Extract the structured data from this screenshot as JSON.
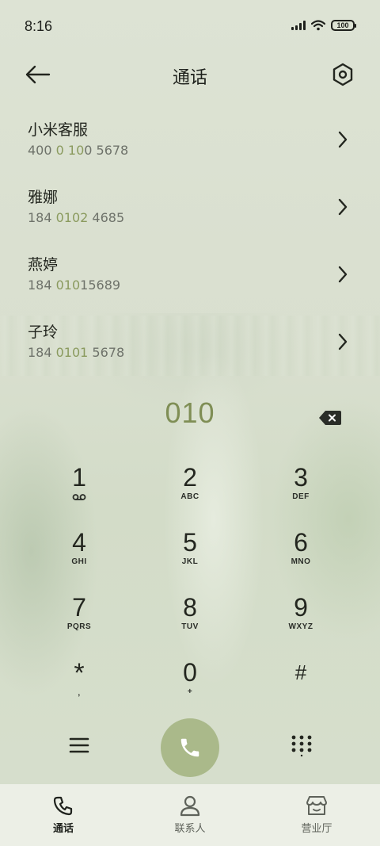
{
  "status_bar": {
    "time": "8:16",
    "battery": "100"
  },
  "header": {
    "title": "通话"
  },
  "contacts": [
    {
      "name": "小米客服",
      "number_pre": "400 ",
      "number_match": "0 10",
      "number_post": "0 5678"
    },
    {
      "name": "雅娜",
      "number_pre": "184 ",
      "number_match": "0102",
      "number_post": " 4685"
    },
    {
      "name": "燕婷",
      "number_pre": "184 ",
      "number_match": "010",
      "number_post": "15689"
    },
    {
      "name": "子玲",
      "number_pre": "184 ",
      "number_match": "0101",
      "number_post": " 5678"
    }
  ],
  "dial": {
    "number": "010"
  },
  "keypad": [
    {
      "digit": "1",
      "sub": ""
    },
    {
      "digit": "2",
      "sub": "ABC"
    },
    {
      "digit": "3",
      "sub": "DEF"
    },
    {
      "digit": "4",
      "sub": "GHI"
    },
    {
      "digit": "5",
      "sub": "JKL"
    },
    {
      "digit": "6",
      "sub": "MNO"
    },
    {
      "digit": "7",
      "sub": "PQRS"
    },
    {
      "digit": "8",
      "sub": "TUV"
    },
    {
      "digit": "9",
      "sub": "WXYZ"
    },
    {
      "digit": "*",
      "sub": ","
    },
    {
      "digit": "0",
      "sub": "+"
    },
    {
      "digit": "#",
      "sub": ""
    }
  ],
  "tabs": [
    {
      "label": "通话",
      "icon": "phone-icon",
      "active": true
    },
    {
      "label": "联系人",
      "icon": "person-icon",
      "active": false
    },
    {
      "label": "营业厅",
      "icon": "store-icon",
      "active": false
    }
  ],
  "colors": {
    "accent": "#8a9a5e",
    "call_button": "#aab98a",
    "dial_number": "#7f8e55"
  }
}
